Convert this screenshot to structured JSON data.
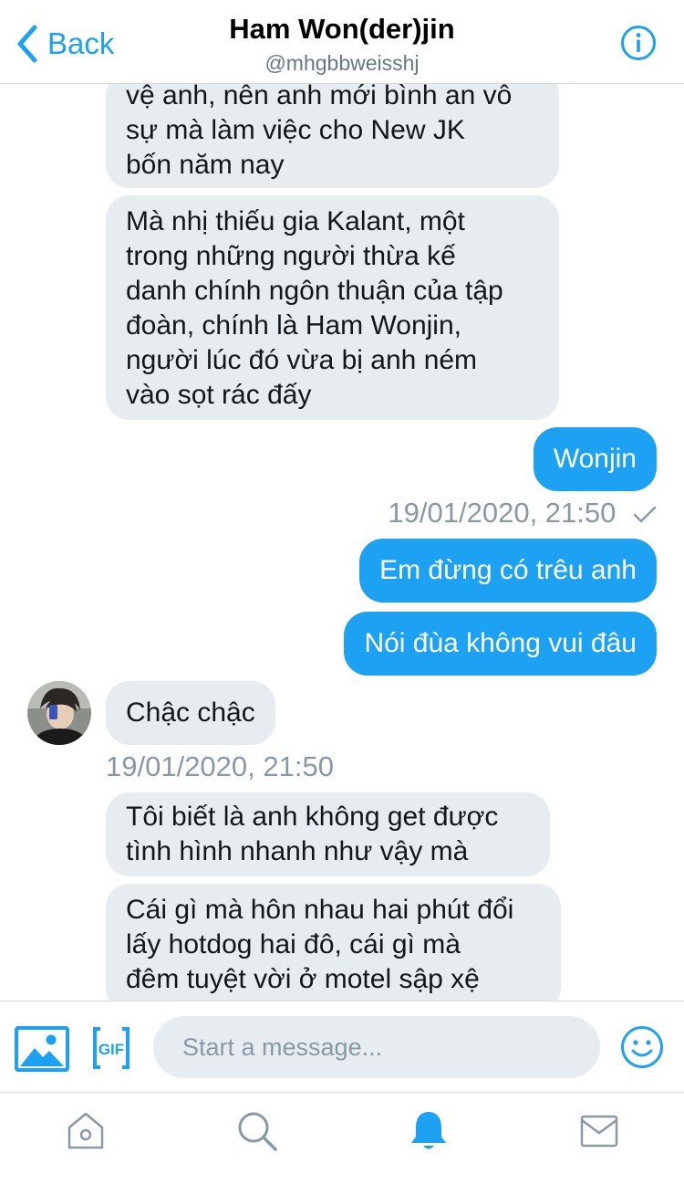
{
  "header": {
    "back_label": "Back",
    "title": "Ham Won(der)jin",
    "handle": "@mhgbbweisshj",
    "info_icon": "info-icon"
  },
  "messages": [
    {
      "direction": "incoming",
      "lines": [
        "vệ anh, nên anh mới bình an vô",
        "sự mà làm việc cho New JK",
        "bốn năm nay"
      ]
    },
    {
      "direction": "incoming",
      "lines": [
        "Mà nhị thiếu gia Kalant, một",
        "trong những người thừa kế",
        "danh chính ngôn thuận của tập",
        "đoàn, chính là Ham Wonjin,",
        "người lúc đó vừa bị anh ném",
        "vào sọt rác đấy"
      ]
    },
    {
      "direction": "outgoing",
      "text": "Wonjin"
    },
    {
      "timestamp": "19/01/2020, 21:50",
      "status_icon": "check-icon"
    },
    {
      "direction": "outgoing",
      "text": "Em đừng có trêu anh"
    },
    {
      "direction": "outgoing",
      "text": "Nói đùa không vui đâu"
    },
    {
      "direction": "incoming",
      "text": "Chậc chậc"
    },
    {
      "timestamp": "19/01/2020, 21:50"
    },
    {
      "direction": "incoming",
      "lines": [
        "Tôi biết là anh không get được",
        "tình hình nhanh như vậy mà"
      ]
    },
    {
      "direction": "incoming",
      "lines": [
        "Cái gì mà hôn nhau hai phút đổi",
        "lấy hotdog hai đô, cái gì mà",
        "đêm tuyệt vời ở motel sập xệ"
      ]
    }
  ],
  "composer": {
    "placeholder": "Start a message...",
    "media_icon": "image-icon",
    "gif_icon": "gif-icon",
    "emoji_icon": "emoji-icon"
  },
  "tabbar": {
    "items": [
      "home-icon",
      "search-icon",
      "notifications-icon",
      "messages-icon"
    ],
    "active": "notifications-icon"
  },
  "colors": {
    "accent": "#1da1f2",
    "incoming_bubble": "#e6ecf0",
    "muted_text": "#8899a6"
  }
}
